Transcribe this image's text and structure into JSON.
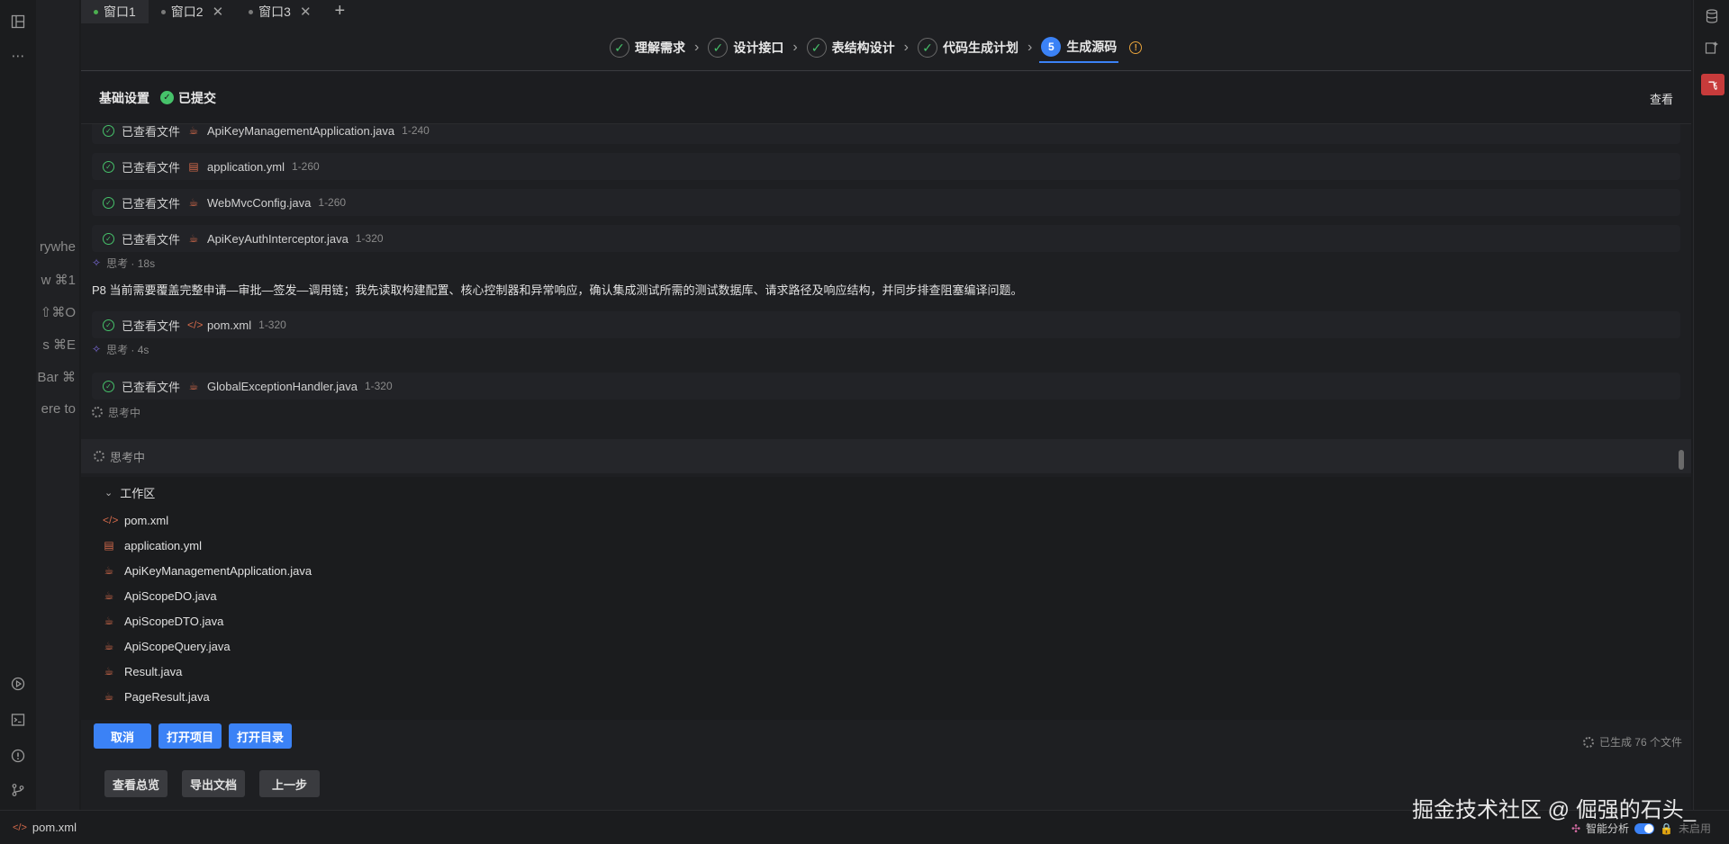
{
  "tabs": [
    {
      "label": "窗口1",
      "active": true
    },
    {
      "label": "窗口2",
      "active": false
    },
    {
      "label": "窗口3",
      "active": false
    }
  ],
  "steps": [
    {
      "label": "理解需求",
      "state": "done"
    },
    {
      "label": "设计接口",
      "state": "done"
    },
    {
      "label": "表结构设计",
      "state": "done"
    },
    {
      "label": "代码生成计划",
      "state": "done"
    },
    {
      "label": "生成源码",
      "state": "current",
      "number": "5"
    }
  ],
  "ghost_lines": [
    "rywhe",
    "w ⌘1",
    "⇧⌘O",
    "s ⌘E",
    "Bar ⌘",
    "ere to"
  ],
  "panel": {
    "title": "基础设置",
    "status": "已提交",
    "view_link": "查看"
  },
  "log": {
    "viewed_label": "已查看文件",
    "rows": [
      {
        "file": "ApiKeyManagementApplication.java",
        "range": "1-240",
        "icon": "java-file-icon"
      },
      {
        "file": "application.yml",
        "range": "1-260",
        "icon": "yml-file-icon"
      },
      {
        "file": "WebMvcConfig.java",
        "range": "1-260",
        "icon": "java-file-icon"
      },
      {
        "file": "ApiKeyAuthInterceptor.java",
        "range": "1-320",
        "icon": "java-file-icon"
      }
    ],
    "think1": "思考 · 18s",
    "paragraph": "P8 当前需要覆盖完整申请—审批—签发—调用链；我先读取构建配置、核心控制器和异常响应，确认集成测试所需的测试数据库、请求路径及响应结构，并同步排查阻塞编译问题。",
    "row5": {
      "file": "pom.xml",
      "range": "1-320",
      "icon": "xml-file-icon"
    },
    "think2": "思考 · 4s",
    "row6": {
      "file": "GlobalExceptionHandler.java",
      "range": "1-320",
      "icon": "java-file-icon"
    },
    "thinking": "思考中"
  },
  "thinking_bar": "思考中",
  "workspace": {
    "title": "工作区",
    "files": [
      {
        "name": "pom.xml",
        "icon": "xml-file-icon"
      },
      {
        "name": "application.yml",
        "icon": "yml-file-icon"
      },
      {
        "name": "ApiKeyManagementApplication.java",
        "icon": "java-file-icon"
      },
      {
        "name": "ApiScopeDO.java",
        "icon": "java-file-icon"
      },
      {
        "name": "ApiScopeDTO.java",
        "icon": "java-file-icon"
      },
      {
        "name": "ApiScopeQuery.java",
        "icon": "java-file-icon"
      },
      {
        "name": "Result.java",
        "icon": "java-file-icon"
      },
      {
        "name": "PageResult.java",
        "icon": "java-file-icon"
      }
    ]
  },
  "buttons": {
    "cancel": "取消",
    "open_project": "打开项目",
    "open_dir": "打开目录",
    "overview": "查看总览",
    "export_doc": "导出文档",
    "prev_step": "上一步"
  },
  "gen_status": "已生成 76 个文件",
  "statusbar": {
    "file": "pom.xml",
    "watermark": "掘金技术社区 @ 倔强的石头_",
    "smart_analysis": "智能分析",
    "disabled": "未启用"
  },
  "colors": {
    "accent": "#3b82f6",
    "success": "#46c26a",
    "warning": "#e6a23c",
    "file_icon": "#d2694a"
  }
}
